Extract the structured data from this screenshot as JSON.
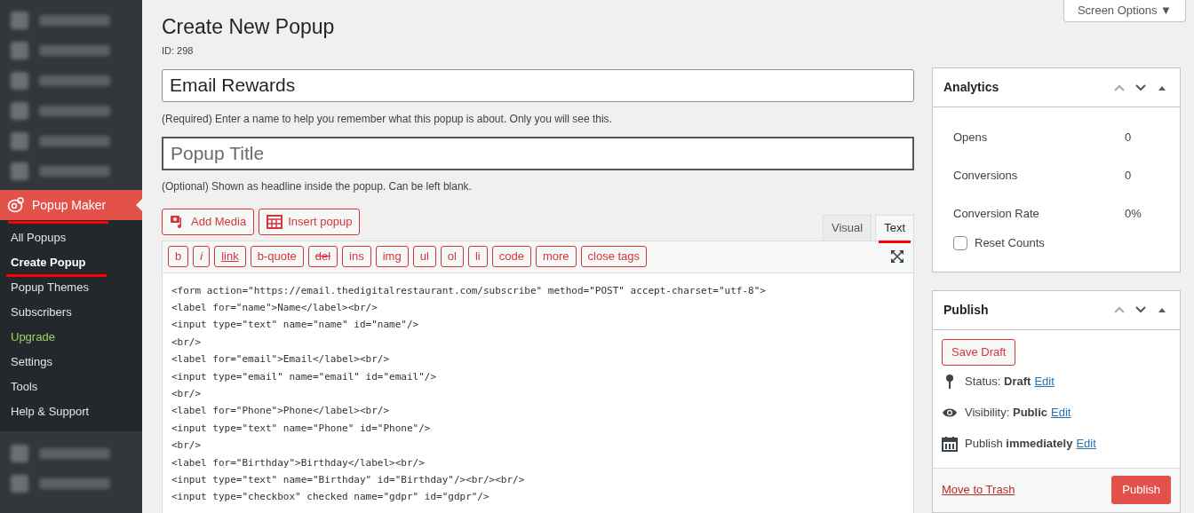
{
  "sidebar": {
    "active_menu": {
      "label": "Popup Maker"
    },
    "submenu": [
      {
        "label": "All Popups",
        "selected": false,
        "kind": "normal"
      },
      {
        "label": "Create Popup",
        "selected": true,
        "kind": "normal"
      },
      {
        "label": "Popup Themes",
        "selected": false,
        "kind": "normal"
      },
      {
        "label": "Subscribers",
        "selected": false,
        "kind": "normal"
      },
      {
        "label": "Upgrade",
        "selected": false,
        "kind": "upgrade"
      },
      {
        "label": "Settings",
        "selected": false,
        "kind": "normal"
      },
      {
        "label": "Tools",
        "selected": false,
        "kind": "normal"
      },
      {
        "label": "Help & Support",
        "selected": false,
        "kind": "normal"
      }
    ]
  },
  "screen_options": "Screen Options ▼",
  "page": {
    "title": "Create New Popup",
    "id_label": "ID: 298"
  },
  "name_field": {
    "value": "Email Rewards",
    "help": "(Required) Enter a name to help you remember what this popup is about. Only you will see this."
  },
  "title_field": {
    "placeholder": "Popup Title",
    "help": "(Optional) Shown as headline inside the popup. Can be left blank."
  },
  "media_buttons": [
    {
      "label": "Add Media",
      "kind": "media"
    },
    {
      "label": "Insert popup",
      "kind": "popup"
    }
  ],
  "editor_tabs": [
    {
      "label": "Visual",
      "selected": false
    },
    {
      "label": "Text",
      "selected": true
    }
  ],
  "quicktags": [
    {
      "label": "b",
      "kind": "plain"
    },
    {
      "label": "i",
      "kind": "italic"
    },
    {
      "label": "link",
      "kind": "underline"
    },
    {
      "label": "b-quote",
      "kind": "plain"
    },
    {
      "label": "del",
      "kind": "strike"
    },
    {
      "label": "ins",
      "kind": "plain"
    },
    {
      "label": "img",
      "kind": "plain"
    },
    {
      "label": "ul",
      "kind": "plain"
    },
    {
      "label": "ol",
      "kind": "plain"
    },
    {
      "label": "li",
      "kind": "plain"
    },
    {
      "label": "code",
      "kind": "plain"
    },
    {
      "label": "more",
      "kind": "plain"
    },
    {
      "label": "close tags",
      "kind": "plain"
    }
  ],
  "code_lines": [
    "<form action=\"https://email.thedigitalrestaurant.com/subscribe\" method=\"POST\" accept-charset=\"utf-8\">",
    "<label for=\"name\">Name</label><br/>",
    "<input type=\"text\" name=\"name\" id=\"name\"/>",
    "<br/>",
    "<label for=\"email\">Email</label><br/>",
    "<input type=\"email\" name=\"email\" id=\"email\"/>",
    "<br/>",
    "<label for=\"Phone\">Phone</label><br/>",
    "<input type=\"text\" name=\"Phone\" id=\"Phone\"/>",
    "<br/>",
    "<label for=\"Birthday\">Birthday</label><br/>",
    "<input type=\"text\" name=\"Birthday\" id=\"Birthday\"/><br/><br/>",
    "<input type=\"checkbox\" checked name=\"gdpr\" id=\"gdpr\"/>"
  ],
  "analytics": {
    "title": "Analytics",
    "stats": [
      {
        "label": "Opens",
        "value": "0"
      },
      {
        "label": "Conversions",
        "value": "0"
      },
      {
        "label": "Conversion Rate",
        "value": "0%"
      }
    ],
    "reset": {
      "label": "Reset Counts",
      "checked": false
    }
  },
  "publish": {
    "title": "Publish",
    "save_draft": "Save Draft",
    "rows": [
      {
        "kind": "status",
        "label": "Status:",
        "value": "Draft",
        "link": "Edit"
      },
      {
        "kind": "visibility",
        "label": "Visibility:",
        "value": "Public",
        "link": "Edit"
      },
      {
        "kind": "schedule",
        "label": "Publish",
        "value": "immediately",
        "link": "Edit"
      }
    ],
    "trash": "Move to Trash",
    "button": "Publish"
  }
}
